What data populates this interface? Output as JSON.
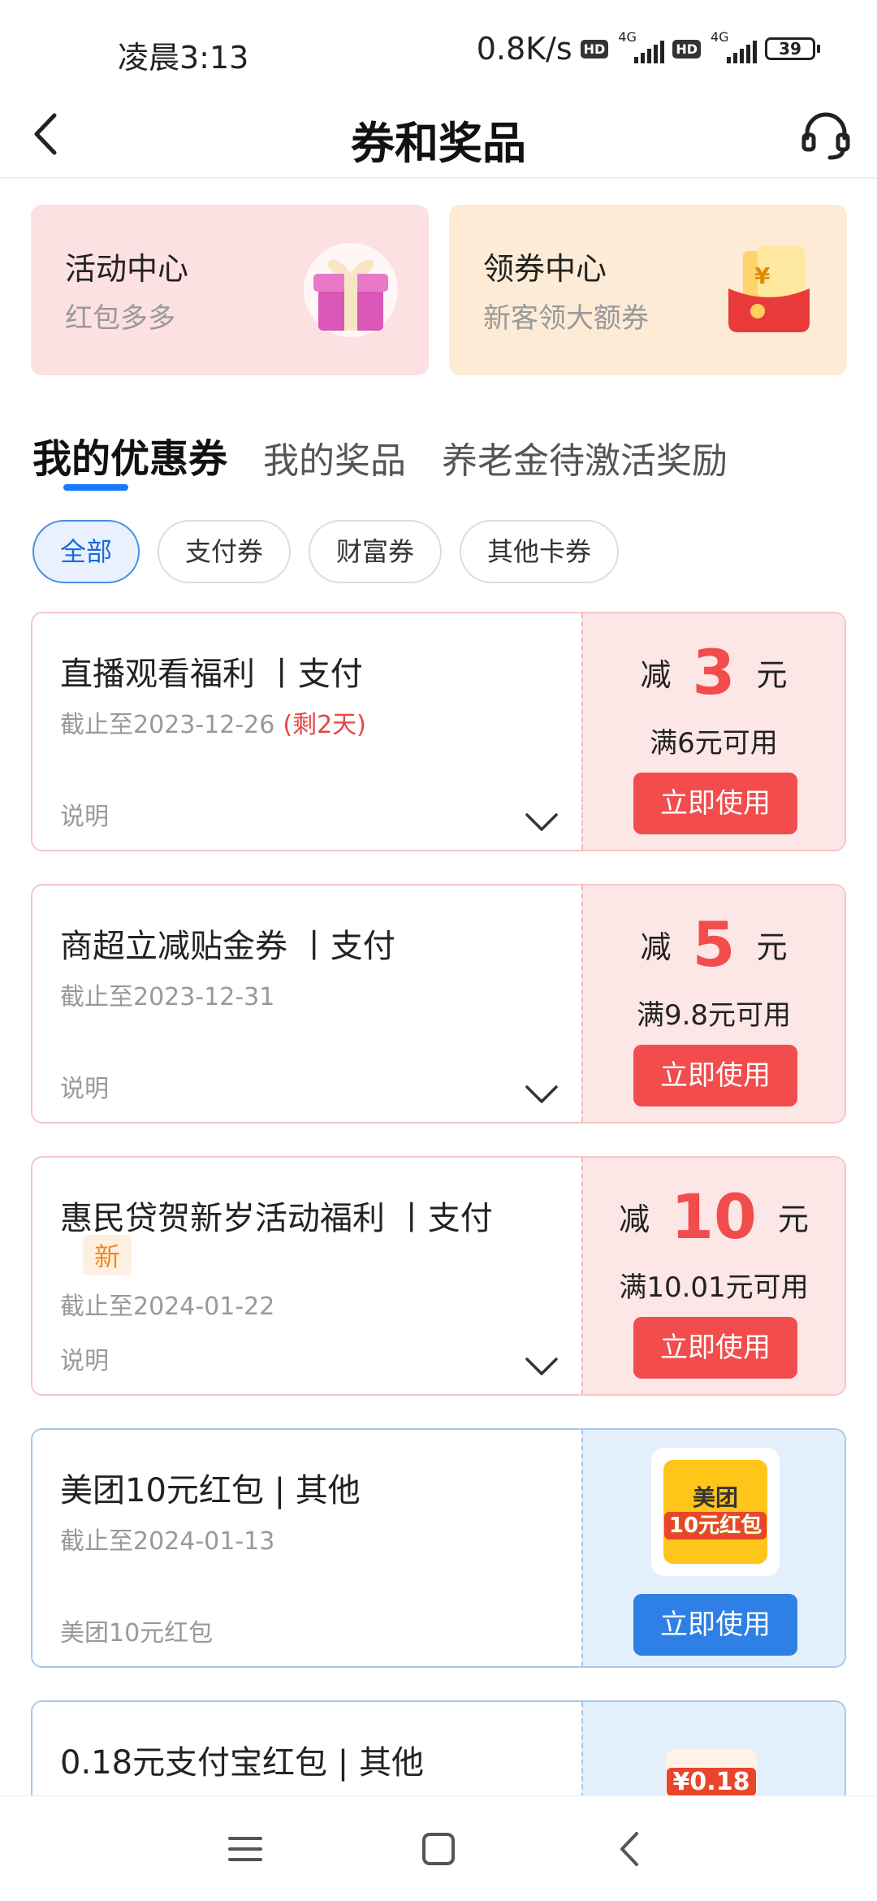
{
  "status_bar": {
    "time": "凌晨3:13",
    "speed": "0.8K/s",
    "hd1": "HD",
    "net1": "4G",
    "hd2": "HD",
    "net2": "4G",
    "battery": "39"
  },
  "header": {
    "title": "券和奖品",
    "back_icon": "back-arrow-icon",
    "service_icon": "headset-icon"
  },
  "top_cards": [
    {
      "title": "活动中心",
      "subtitle": "红包多多",
      "icon": "gift-box-icon"
    },
    {
      "title": "领券中心",
      "subtitle": "新客领大额券",
      "icon": "red-envelope-icon"
    }
  ],
  "tabs": [
    {
      "label": "我的优惠券",
      "active": true
    },
    {
      "label": "我的奖品",
      "active": false
    },
    {
      "label": "养老金待激活奖励",
      "active": false
    }
  ],
  "filters": [
    {
      "label": "全部",
      "active": true
    },
    {
      "label": "支付券",
      "active": false
    },
    {
      "label": "财富券",
      "active": false
    },
    {
      "label": "其他卡券",
      "active": false
    }
  ],
  "coupons": [
    {
      "title": "直播观看福利 丨支付",
      "expiry": "截止至2023-12-26",
      "remain": "(剩2天)",
      "note": "说明",
      "prefix": "减",
      "amount": "3",
      "unit": "元",
      "condition": "满6元可用",
      "button": "立即使用"
    },
    {
      "title": "商超立减贴金券 丨支付",
      "expiry": "截止至2023-12-31",
      "note": "说明",
      "prefix": "减",
      "amount": "5",
      "unit": "元",
      "condition": "满9.8元可用",
      "button": "立即使用"
    },
    {
      "title": "惠民贷贺新岁活动福利 丨支付",
      "badge": "新",
      "expiry": "截止至2024-01-22",
      "note": "说明",
      "prefix": "减",
      "amount": "10",
      "unit": "元",
      "condition": "满10.01元可用",
      "button": "立即使用"
    },
    {
      "title": "美团10元红包 | 其他",
      "expiry": "截止至2024-01-13",
      "note": "美团10元红包",
      "thumb_brand": "美团",
      "thumb_amount": "10元红包",
      "button": "立即使用"
    },
    {
      "title": "0.18元支付宝红包 | 其他",
      "thumb_amount": "¥0.18"
    }
  ],
  "nav": {
    "menu_icon": "menu-icon",
    "home_icon": "home-square-icon",
    "back_icon": "back-chevron-icon"
  },
  "colors": {
    "accent_blue": "#1677ff",
    "coupon_red": "#f24c4c",
    "coupon_blue_button": "#2f80e6"
  }
}
